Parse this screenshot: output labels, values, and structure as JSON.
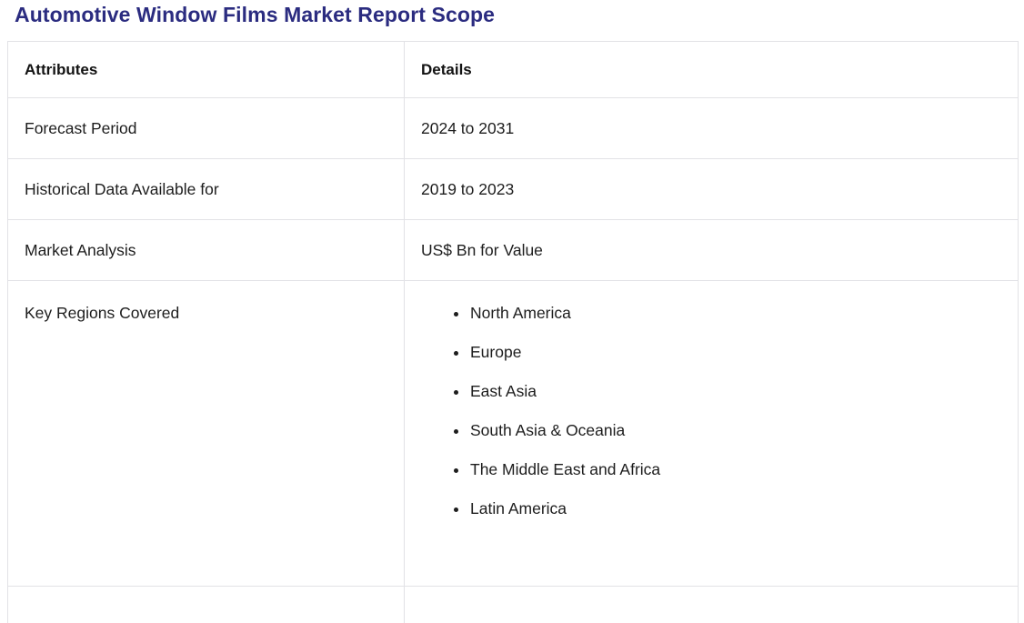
{
  "title": "Automotive Window Films Market Report Scope",
  "colors": {
    "title_text": "#2b2c80",
    "body_text": "#1d1d1d",
    "table_border": "#e2e2e6",
    "background": "#ffffff"
  },
  "table": {
    "headers": {
      "attribute": "Attributes",
      "detail": "Details"
    },
    "rows": [
      {
        "attribute": "Forecast Period",
        "detail": "2024 to 2031"
      },
      {
        "attribute": "Historical Data Available for",
        "detail": "2019 to 2023"
      },
      {
        "attribute": "Market Analysis",
        "detail": "US$ Bn for Value"
      },
      {
        "attribute": "Key Regions Covered",
        "regions": [
          "North America",
          "Europe",
          "East Asia",
          "South Asia & Oceania",
          "The Middle East and Africa",
          "Latin America"
        ]
      }
    ]
  }
}
